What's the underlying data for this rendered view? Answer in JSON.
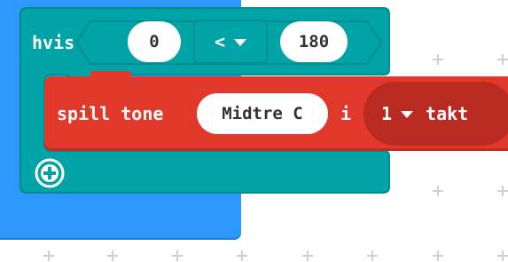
{
  "colors": {
    "outer_block": "#2f98ff",
    "logic_block": "#00a4a6",
    "music_block": "#e0382a",
    "music_dropdown": "#b92b20"
  },
  "if_block": {
    "keyword": "hvis",
    "left_operand": "0",
    "operator": "<",
    "right_operand": "180"
  },
  "tone_block": {
    "label": "spill tone",
    "note": "Midtre C",
    "connector": "i",
    "beats_value": "1",
    "beats_unit": "takt"
  },
  "icons": {
    "add": "plus-circle-icon",
    "operator_caret": "chevron-down-icon",
    "beats_caret": "chevron-down-icon"
  }
}
